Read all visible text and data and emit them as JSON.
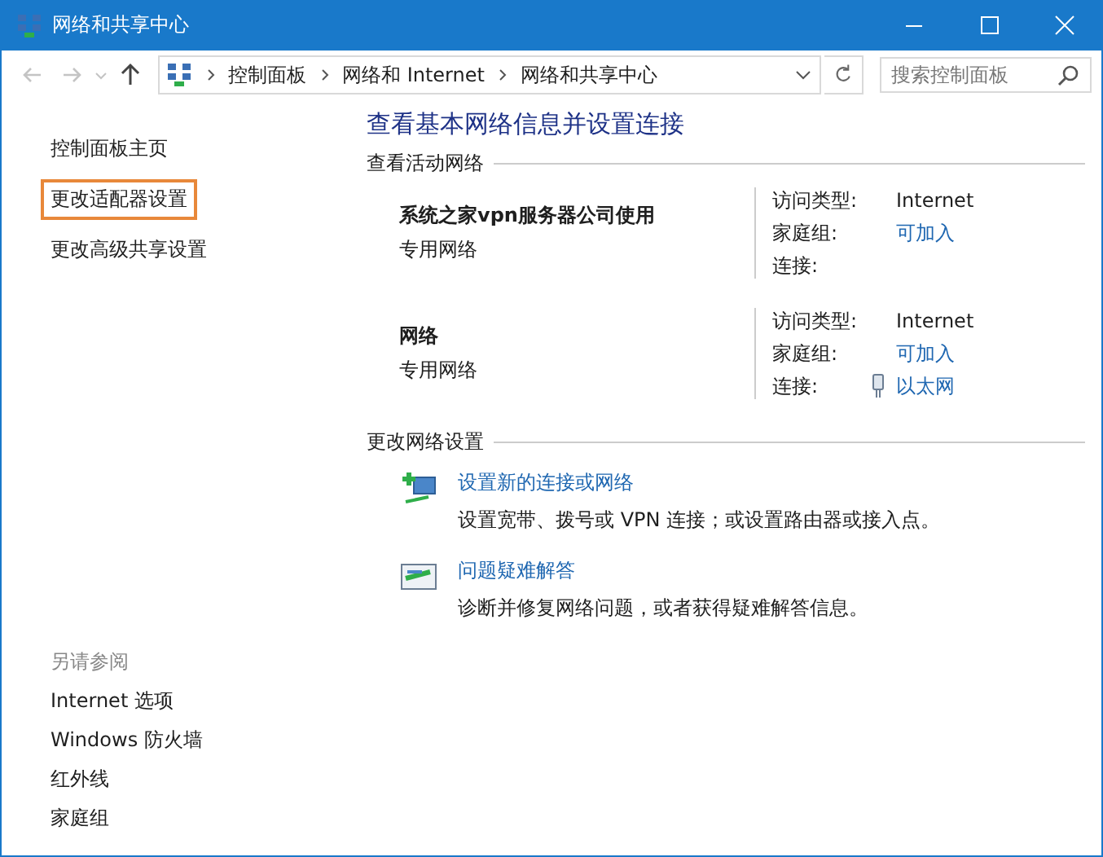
{
  "window": {
    "title": "网络和共享中心"
  },
  "address_bar": {
    "crumbs": [
      "控制面板",
      "网络和 Internet",
      "网络和共享中心"
    ],
    "search_placeholder": "搜索控制面板"
  },
  "sidebar": {
    "items": [
      {
        "label": "控制面板主页",
        "highlighted": false
      },
      {
        "label": "更改适配器设置",
        "highlighted": true
      },
      {
        "label": "更改高级共享设置",
        "highlighted": false
      }
    ],
    "see_also_title": "另请参阅",
    "see_also": [
      "Internet 选项",
      "Windows 防火墙",
      "红外线",
      "家庭组"
    ]
  },
  "main": {
    "heading": "查看基本网络信息并设置连接",
    "active_networks_title": "查看活动网络",
    "networks": [
      {
        "name": "系统之家vpn服务器公司使用",
        "type": "专用网络",
        "details": [
          {
            "label": "访问类型:",
            "value": "Internet",
            "kind": "text"
          },
          {
            "label": "家庭组:",
            "value": "可加入",
            "kind": "link"
          },
          {
            "label": "连接:",
            "kind": "text"
          }
        ]
      },
      {
        "name": "网络",
        "type": "专用网络",
        "details": [
          {
            "label": "访问类型:",
            "value": "Internet",
            "kind": "text"
          },
          {
            "label": "家庭组:",
            "value": "可加入",
            "kind": "link"
          },
          {
            "label": "连接:",
            "value": "以太网",
            "kind": "ethernet"
          }
        ]
      }
    ],
    "change_settings_title": "更改网络设置",
    "tasks": [
      {
        "kind": "new-connection",
        "link": "设置新的连接或网络",
        "description": "设置宽带、拨号或 VPN 连接；或设置路由器或接入点。"
      },
      {
        "kind": "troubleshoot",
        "link": "问题疑难解答",
        "description": "诊断并修复网络问题，或者获得疑难解答信息。"
      }
    ]
  }
}
